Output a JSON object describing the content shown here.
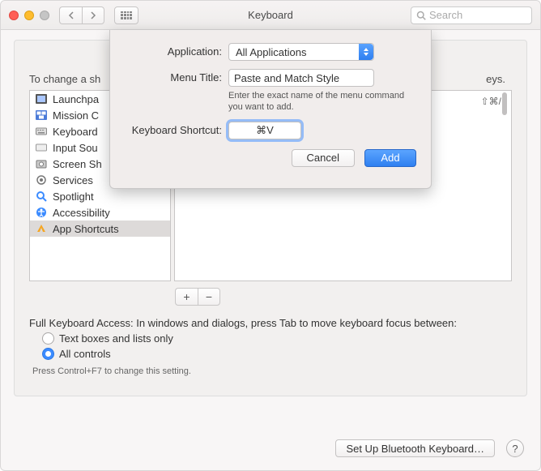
{
  "window": {
    "title": "Keyboard",
    "search_placeholder": "Search"
  },
  "main": {
    "description_prefix": "To change a sh",
    "description_suffix": "eys.",
    "add_icon": "+",
    "remove_icon": "−",
    "right_shortcut_hint": "⇧⌘/",
    "fka_label": "Full Keyboard Access: In windows and dialogs, press Tab to move keyboard focus between:",
    "fka_option1": "Text boxes and lists only",
    "fka_option2": "All controls",
    "fka_note": "Press Control+F7 to change this setting.",
    "bluetooth_button": "Set Up Bluetooth Keyboard…",
    "help_label": "?"
  },
  "sidebar": {
    "items": [
      {
        "label": "Launchpa"
      },
      {
        "label": "Mission C"
      },
      {
        "label": "Keyboard"
      },
      {
        "label": "Input Sou"
      },
      {
        "label": "Screen Sh"
      },
      {
        "label": "Services"
      },
      {
        "label": "Spotlight"
      },
      {
        "label": "Accessibility"
      },
      {
        "label": "App Shortcuts"
      }
    ]
  },
  "sheet": {
    "labels": {
      "application": "Application:",
      "menu_title": "Menu Title:",
      "shortcut": "Keyboard Shortcut:"
    },
    "application_value": "All Applications",
    "menu_title_value": "Paste and Match Style",
    "menu_help": "Enter the exact name of the menu command you want to add.",
    "shortcut_value": "⌘V",
    "cancel": "Cancel",
    "add": "Add"
  }
}
